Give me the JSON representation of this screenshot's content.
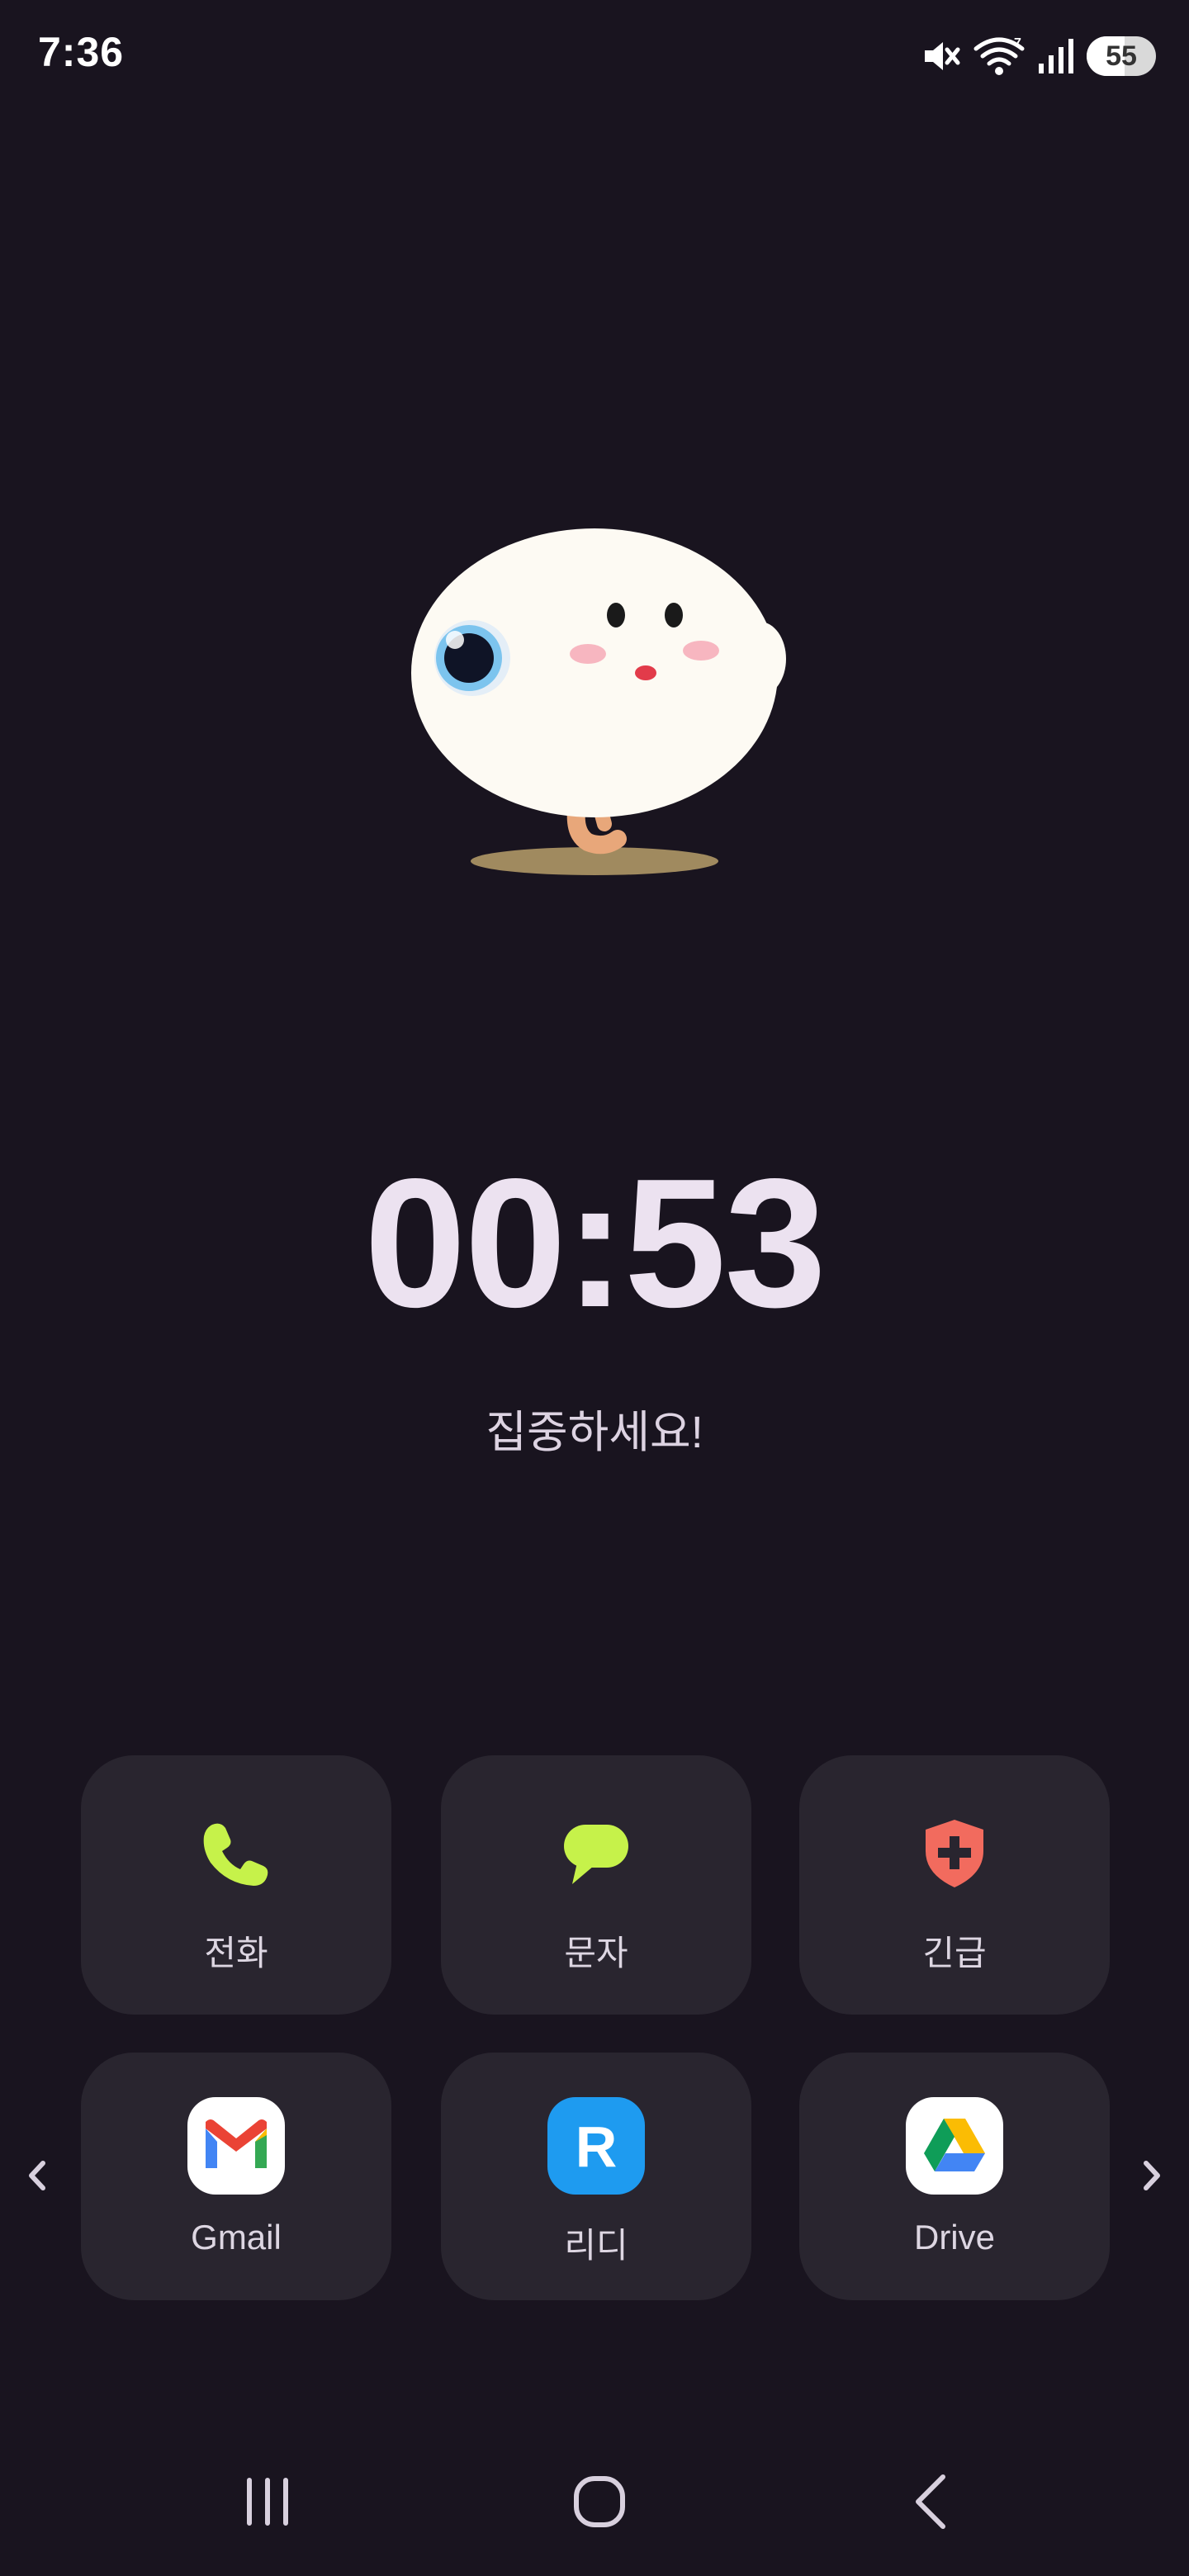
{
  "status_bar": {
    "time": "7:36",
    "battery_level": "55",
    "icons": [
      "mute-icon",
      "wifi-icon",
      "signal-icon",
      "battery-icon"
    ]
  },
  "timer": {
    "display": "00:53",
    "message": "집중하세요!"
  },
  "quick_actions": [
    {
      "label": "전화",
      "icon": "phone-icon",
      "color": "#c6f24a"
    },
    {
      "label": "문자",
      "icon": "message-icon",
      "color": "#c6f24a"
    },
    {
      "label": "긴급",
      "icon": "emergency-shield-icon",
      "color": "#f26b5e"
    }
  ],
  "apps": [
    {
      "label": "Gmail",
      "icon": "gmail-icon"
    },
    {
      "label": "리디",
      "icon": "ridi-icon",
      "color": "#1e9bf0"
    },
    {
      "label": "Drive",
      "icon": "drive-icon"
    }
  ],
  "colors": {
    "background": "#19141f",
    "tile": "#29252f",
    "timer_text": "#ece2f0",
    "accent_green": "#c6f24a"
  }
}
